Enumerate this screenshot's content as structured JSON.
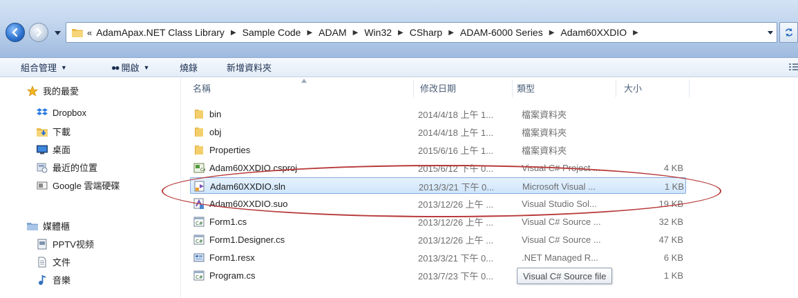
{
  "breadcrumb": {
    "overflow": "«",
    "items": [
      "AdamApax.NET Class Library",
      "Sample Code",
      "ADAM",
      "Win32",
      "CSharp",
      "ADAM-6000 Series",
      "Adam60XXDIO"
    ]
  },
  "toolbar": {
    "organize": "組合管理",
    "open": "開啟",
    "burn": "燒錄",
    "new_folder": "新增資料夾"
  },
  "nav": {
    "favorites": "我的最愛",
    "dropbox": "Dropbox",
    "downloads": "下載",
    "desktop": "桌面",
    "recent": "最近的位置",
    "google_drive": "Google 雲端硬碟",
    "libraries": "媒體櫃",
    "pptv": "PPTV视频",
    "documents": "文件",
    "music": "音樂"
  },
  "columns": {
    "name": "名稱",
    "date": "修改日期",
    "type": "類型",
    "size": "大小"
  },
  "files": [
    {
      "name": "bin",
      "date": "2014/4/18 上午 1...",
      "type": "檔案資料夾",
      "size": "",
      "icon": "folder-icon"
    },
    {
      "name": "obj",
      "date": "2014/4/18 上午 1...",
      "type": "檔案資料夾",
      "size": "",
      "icon": "folder-icon"
    },
    {
      "name": "Properties",
      "date": "2015/6/16 上午 1...",
      "type": "檔案資料夾",
      "size": "",
      "icon": "folder-icon"
    },
    {
      "name": "Adam60XXDIO.csproj",
      "date": "2015/6/12 下午 0...",
      "type": "Visual C# Project ...",
      "size": "4 KB",
      "icon": "csproj-icon"
    },
    {
      "name": "Adam60XXDIO.sln",
      "date": "2013/3/21 下午 0...",
      "type": "Microsoft Visual ...",
      "size": "1 KB",
      "icon": "sln-icon"
    },
    {
      "name": "Adam60XXDIO.suo",
      "date": "2013/12/26 上午 ...",
      "type": "Visual Studio Sol...",
      "size": "19 KB",
      "icon": "suo-icon"
    },
    {
      "name": "Form1.cs",
      "date": "2013/12/26 上午 ...",
      "type": "Visual C# Source ...",
      "size": "32 KB",
      "icon": "cs-file-icon"
    },
    {
      "name": "Form1.Designer.cs",
      "date": "2013/12/26 上午 ...",
      "type": "Visual C# Source ...",
      "size": "47 KB",
      "icon": "cs-file-icon"
    },
    {
      "name": "Form1.resx",
      "date": "2013/3/21 下午 0...",
      "type": ".NET Managed R...",
      "size": "6 KB",
      "icon": "resx-icon"
    },
    {
      "name": "Program.cs",
      "date": "2013/7/23 下午 0...",
      "type": "",
      "size": "1 KB",
      "icon": "cs-file-icon"
    }
  ],
  "tooltip": "Visual C# Source file",
  "colors": {
    "selection": "#cfe5fb",
    "selection_border": "#84acdd",
    "annotation": "#b83a3a"
  }
}
